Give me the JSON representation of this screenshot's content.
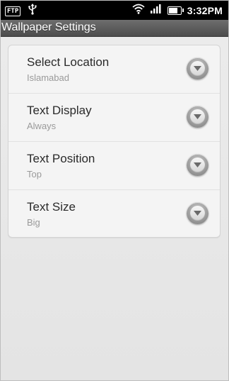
{
  "status_bar": {
    "ftp_label": "FTP",
    "time": "3:32PM",
    "icons": [
      "ftp-icon",
      "usb-icon",
      "wifi-icon",
      "signal-icon",
      "battery-icon"
    ]
  },
  "title_bar": {
    "title": "Wallpaper Settings"
  },
  "settings": [
    {
      "label": "Select Location",
      "value": "Islamabad",
      "icon": "chevron-down-icon"
    },
    {
      "label": "Text Display",
      "value": "Always",
      "icon": "chevron-down-icon"
    },
    {
      "label": "Text Position",
      "value": "Top",
      "icon": "chevron-down-icon"
    },
    {
      "label": "Text Size",
      "value": "Big",
      "icon": "chevron-down-icon"
    }
  ],
  "colors": {
    "background": "#e6e6e6",
    "card": "#f4f4f4",
    "title_bar": "#5a5a5a",
    "status_bar": "#000000"
  }
}
